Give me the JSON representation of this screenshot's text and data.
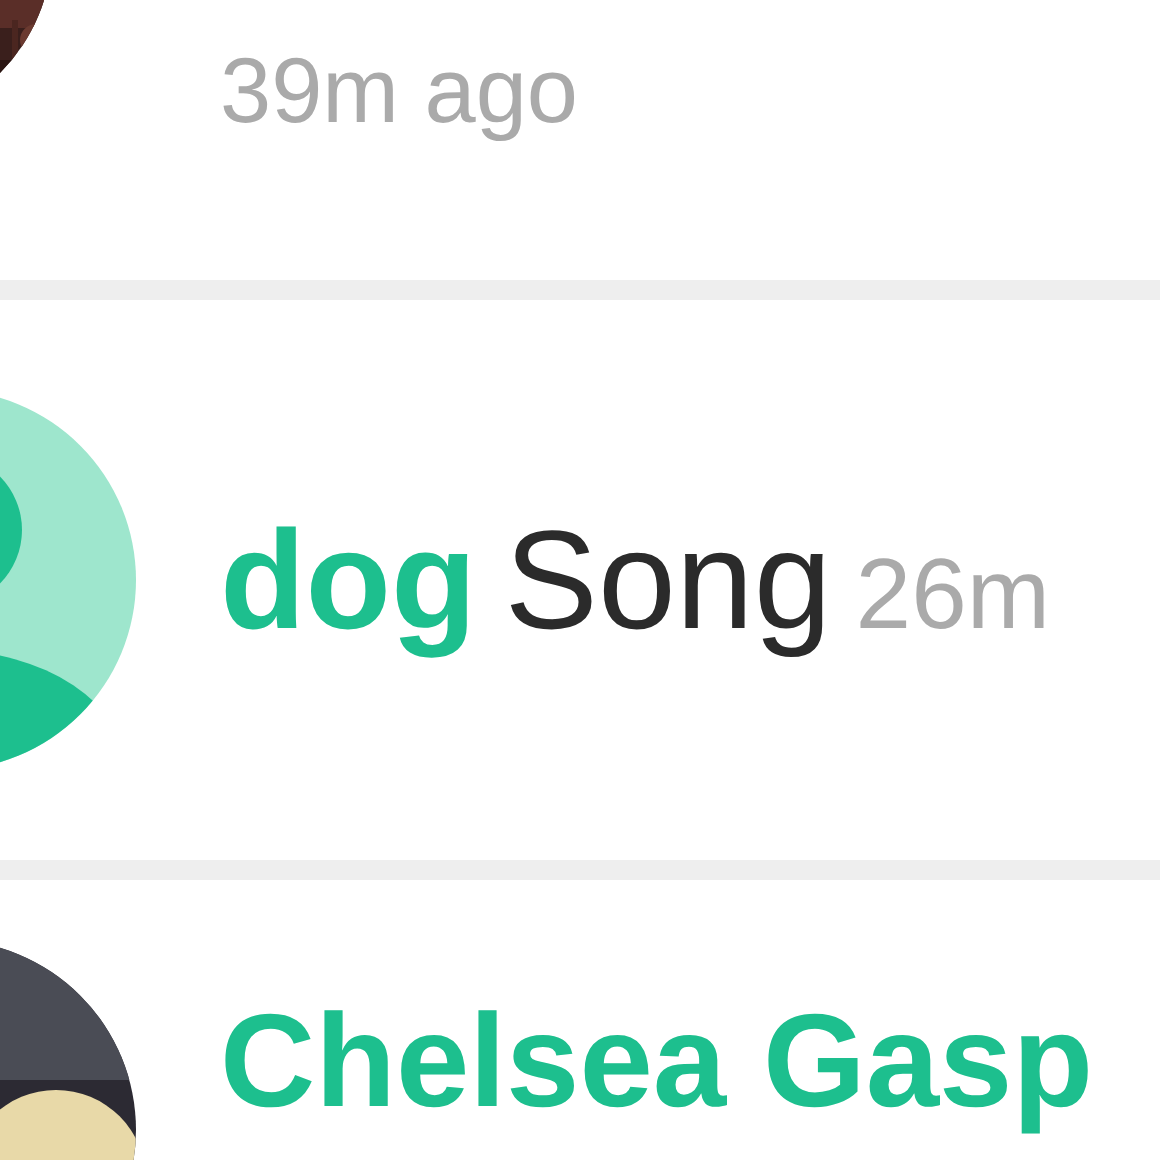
{
  "posts": [
    {
      "time": "39m ago"
    },
    {
      "avatar": {
        "kind": "default"
      },
      "user": "dog",
      "text": "Song",
      "time": "26m"
    },
    {
      "user": "Chelsea Gasp"
    }
  ]
}
